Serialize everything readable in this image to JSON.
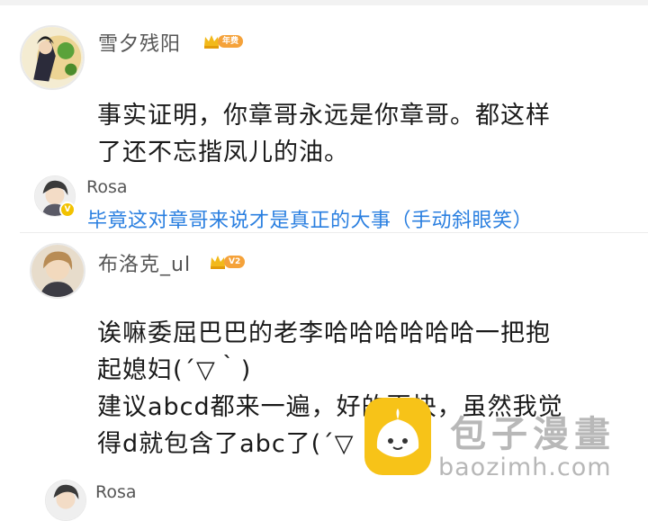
{
  "comments": [
    {
      "username": "雪夕残阳",
      "badge": "年费",
      "lines": [
        "事实证明，你章哥永远是你章哥。都这样",
        "了还不忘揩凤儿的油。"
      ]
    },
    {
      "username": "布洛克_ul",
      "badge": "V2",
      "lines": [
        "诶嘛委屈巴巴的老李哈哈哈哈哈哈一把抱",
        "起媳妇(´▽｀)",
        "建议abcd都来一遍，好的更快，虽然我觉",
        "得d就包含了abc了(´▽"
      ]
    }
  ],
  "reply": {
    "username": "Rosa",
    "verified": "V",
    "text": "毕竟这对章哥来说才是真正的大事（手动斜眼笑）"
  },
  "bottom_reply": {
    "username": "Rosa"
  },
  "watermark": {
    "title": "包子漫畫",
    "url": "baozimh.com"
  },
  "colors": {
    "link": "#2a7fe0",
    "badge": "#f5a23a",
    "crown": "#f2b91a"
  }
}
